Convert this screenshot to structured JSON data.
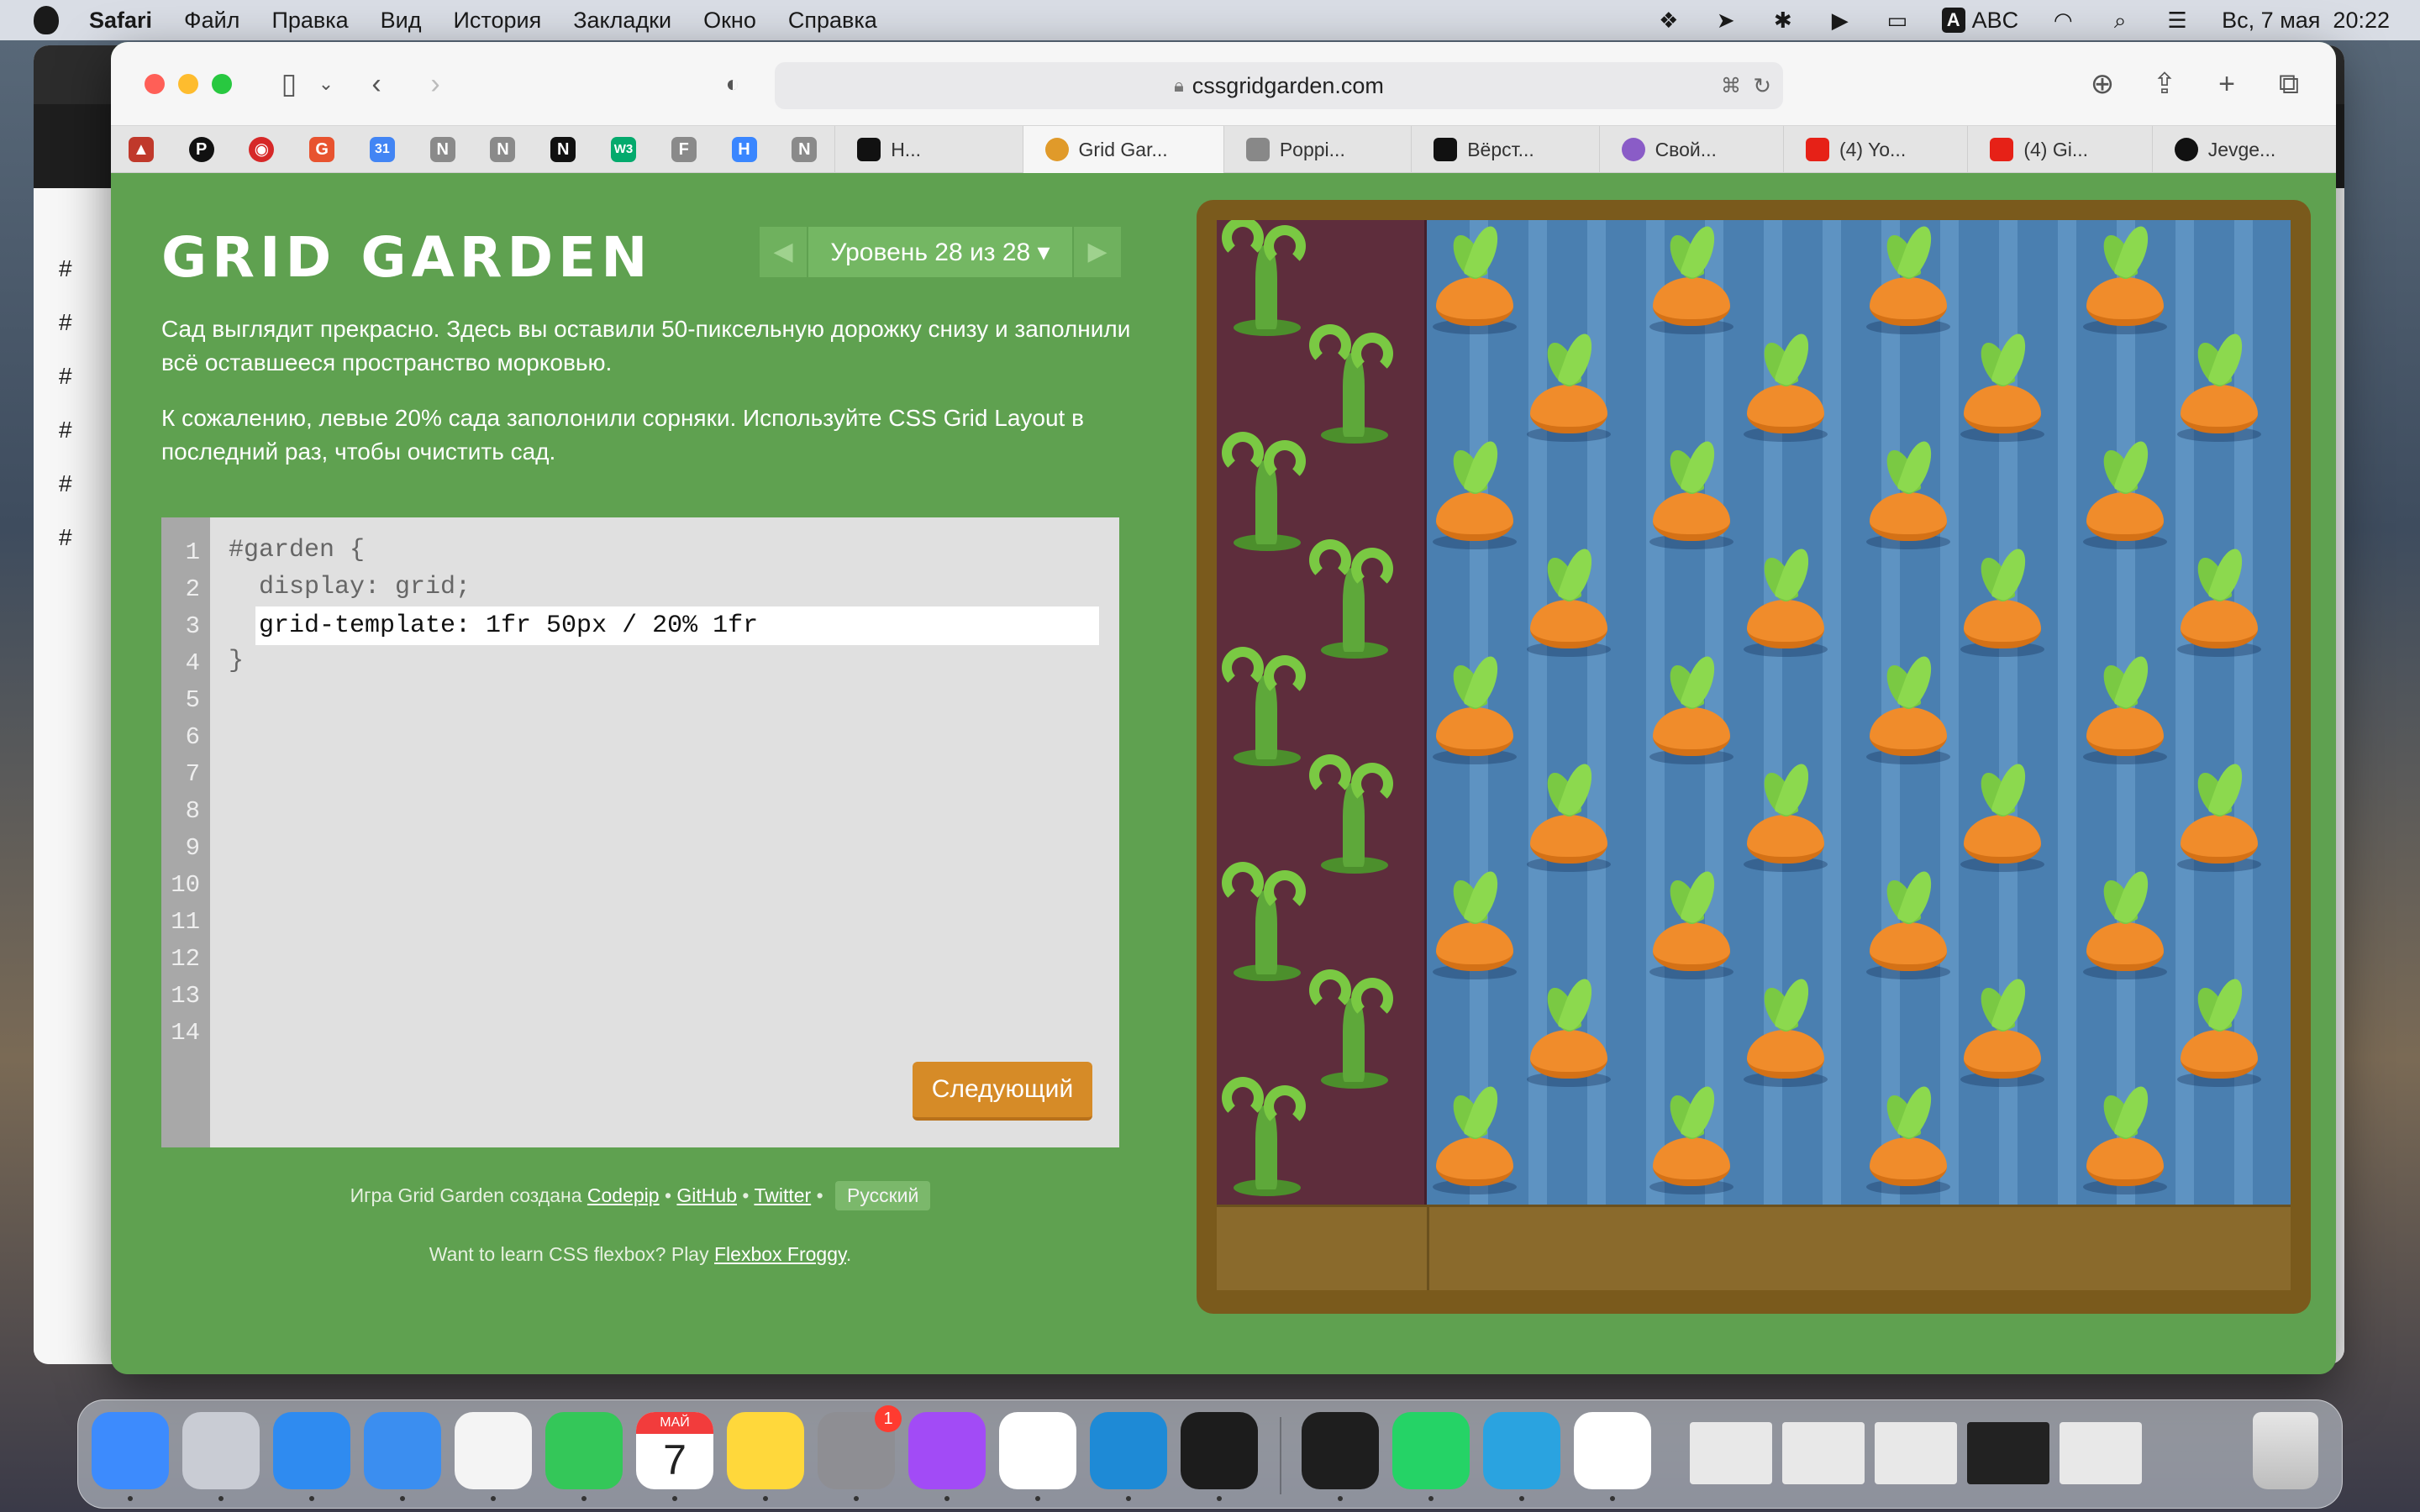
{
  "menubar": {
    "app": "Safari",
    "items": [
      "Файл",
      "Правка",
      "Вид",
      "История",
      "Закладки",
      "Окно",
      "Справка"
    ],
    "input_source": "ABC",
    "input_badge": "A",
    "date": "Вс, 7 мая",
    "time": "20:22"
  },
  "browser": {
    "url": "cssgridgarden.com",
    "tabs": [
      {
        "label": "Н...",
        "color": "#111111"
      },
      {
        "label": "Grid Gar...",
        "color": "#e09a2a",
        "active": true
      },
      {
        "label": "Poppi...",
        "color": "#888888"
      },
      {
        "label": "Вёрст...",
        "color": "#111111"
      },
      {
        "label": "Свой...",
        "color": "#8a5cc7"
      },
      {
        "label": "(4) Yo...",
        "color": "#e62117"
      },
      {
        "label": "(4) Gi...",
        "color": "#e62117"
      },
      {
        "label": "Jevge...",
        "color": "#111111"
      }
    ],
    "favorites": [
      {
        "icon": "triangle-warning-icon",
        "glyph": "▲",
        "color": "#c0392b"
      },
      {
        "icon": "p-icon",
        "glyph": "P",
        "color": "#111111"
      },
      {
        "icon": "target-icon",
        "glyph": "◉",
        "color": "#d62828"
      },
      {
        "icon": "g-icon",
        "glyph": "G",
        "color": "#e8532f"
      },
      {
        "icon": "calendar-31-icon",
        "glyph": "31",
        "color": "#4285f4"
      },
      {
        "icon": "n-gray-icon",
        "glyph": "N",
        "color": "#8a8a8a"
      },
      {
        "icon": "n-gray-icon",
        "glyph": "N",
        "color": "#8a8a8a"
      },
      {
        "icon": "notion-icon",
        "glyph": "N",
        "color": "#111111"
      },
      {
        "icon": "w3-icon",
        "glyph": "W3",
        "color": "#04aa6d"
      },
      {
        "icon": "f-icon",
        "glyph": "F",
        "color": "#8a8a8a"
      },
      {
        "icon": "h-icon",
        "glyph": "H",
        "color": "#3a86ff"
      },
      {
        "icon": "n-gray-icon",
        "glyph": "N",
        "color": "#8a8a8a"
      }
    ]
  },
  "game": {
    "title": "GRID GARDEN",
    "level_label": "Уровень 28 из 28 ▾",
    "prev_arrow": "◀",
    "next_arrow": "▶",
    "instructions": [
      "Сад выглядит прекрасно. Здесь вы оставили 50-пиксельную дорожку снизу и заполнили всё оставшееся пространство морковью.",
      "К сожалению, левые 20% сада заполонили сорняки. Используйте CSS Grid Layout в последний раз, чтобы очистить сад."
    ],
    "editor": {
      "line_numbers": "1\n2\n3\n4\n5\n6\n7\n8\n9\n10\n11\n12\n13\n14",
      "line1": "#garden {",
      "line2": "  display: grid;",
      "input_value": "grid-template: 1fr 50px / 20% 1fr",
      "line4": "}"
    },
    "next_button": "Следующий",
    "credits": {
      "prefix": "Игра Grid Garden создана",
      "codepip": "Codepip",
      "sep": "•",
      "github": "GitHub",
      "twitter": "Twitter",
      "language": "Русский"
    },
    "froggy": {
      "prefix": "Want to learn CSS flexbox? Play",
      "link": "Flexbox Froggy",
      "suffix": "."
    }
  },
  "dock": {
    "apps": [
      {
        "name": "finder-icon",
        "color": "#3d8bfd"
      },
      {
        "name": "launchpad-icon",
        "color": "#c9ccd4"
      },
      {
        "name": "safari-icon",
        "color": "#2f8bf0"
      },
      {
        "name": "mail-icon",
        "color": "#3b8ef0"
      },
      {
        "name": "photos-icon",
        "color": "#f4f4f4"
      },
      {
        "name": "facetime-icon",
        "color": "#34c759"
      },
      {
        "name": "calendar-icon",
        "color": "#ffffff"
      },
      {
        "name": "notes-icon",
        "color": "#ffd83b"
      },
      {
        "name": "system-settings-icon",
        "color": "#8e8e93"
      },
      {
        "name": "messenger-icon",
        "color": "#a24bf6"
      },
      {
        "name": "slack-icon",
        "color": "#ffffff"
      },
      {
        "name": "vscode-icon",
        "color": "#1e8ad6"
      },
      {
        "name": "terminal-icon",
        "color": "#1c1c1c"
      },
      {
        "name": "figma-icon",
        "color": "#1e1e1e"
      },
      {
        "name": "whatsapp-icon",
        "color": "#25d366"
      },
      {
        "name": "telegram-icon",
        "color": "#2aa3e0"
      },
      {
        "name": "chrome-icon",
        "color": "#ffffff"
      }
    ],
    "calendar_month": "МАЙ",
    "calendar_day": "7",
    "settings_badge": "1"
  }
}
